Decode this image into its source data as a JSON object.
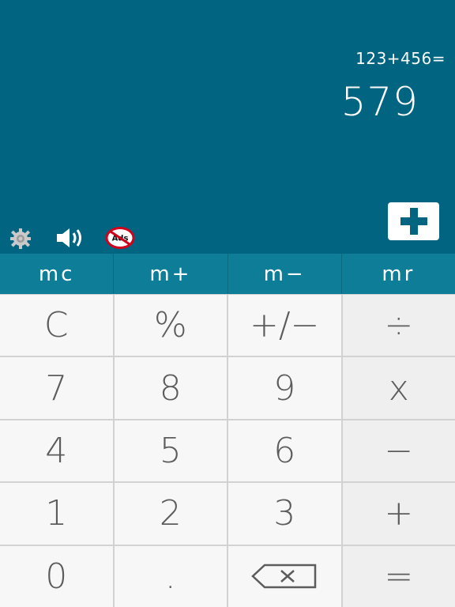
{
  "display": {
    "expression": "123+456=",
    "result": "579"
  },
  "toolbar": {
    "settings_icon": "gear-icon",
    "sound_icon": "speaker-icon",
    "noads_icon": "no-ads-icon",
    "noads_label": "Ads",
    "add_icon": "plus-icon"
  },
  "memory": {
    "mc": "mc",
    "mplus": "m+",
    "mminus": "m−",
    "mr": "mr"
  },
  "keys": {
    "clear": "C",
    "percent": "%",
    "sign": "+/−",
    "divide": "÷",
    "seven": "7",
    "eight": "8",
    "nine": "9",
    "multiply": "x",
    "four": "4",
    "five": "5",
    "six": "6",
    "minus": "−",
    "one": "1",
    "two": "2",
    "three": "3",
    "plus": "+",
    "zero": "0",
    "dot": ".",
    "backspace_icon": "backspace-icon",
    "equals": "="
  },
  "colors": {
    "display_bg": "#016480",
    "memory_bg": "#0d7d98",
    "key_bg": "#f7f7f7",
    "key_text": "#5c5c5c",
    "noads_red": "#d0021b"
  }
}
